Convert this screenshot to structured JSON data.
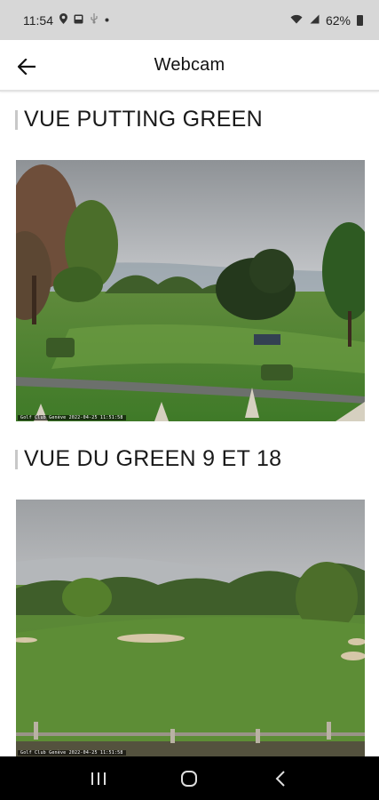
{
  "status_bar": {
    "time": "11:54",
    "battery": "62%",
    "icons": [
      "location-icon",
      "gallery-icon",
      "usb-icon",
      "dot-icon",
      "wifi-icon",
      "signal-icon",
      "battery-icon"
    ]
  },
  "app_bar": {
    "title": "Webcam",
    "back_icon": "arrow-left-icon"
  },
  "webcams": [
    {
      "title": "VUE PUTTING GREEN",
      "stamp": "Golf Club Genève 2022-04-25 11:51:58"
    },
    {
      "title": "VUE DU GREEN 9 ET 18",
      "stamp": "Golf Club Genève 2022-04-25 11:51:58"
    }
  ],
  "nav_bar": {
    "icons": [
      "recent-apps-icon",
      "home-icon",
      "back-icon"
    ]
  },
  "colors": {
    "status_bar_bg": "#d7d7d7",
    "nav_bar_bg": "#000000",
    "grass": "#5e8a3c"
  }
}
